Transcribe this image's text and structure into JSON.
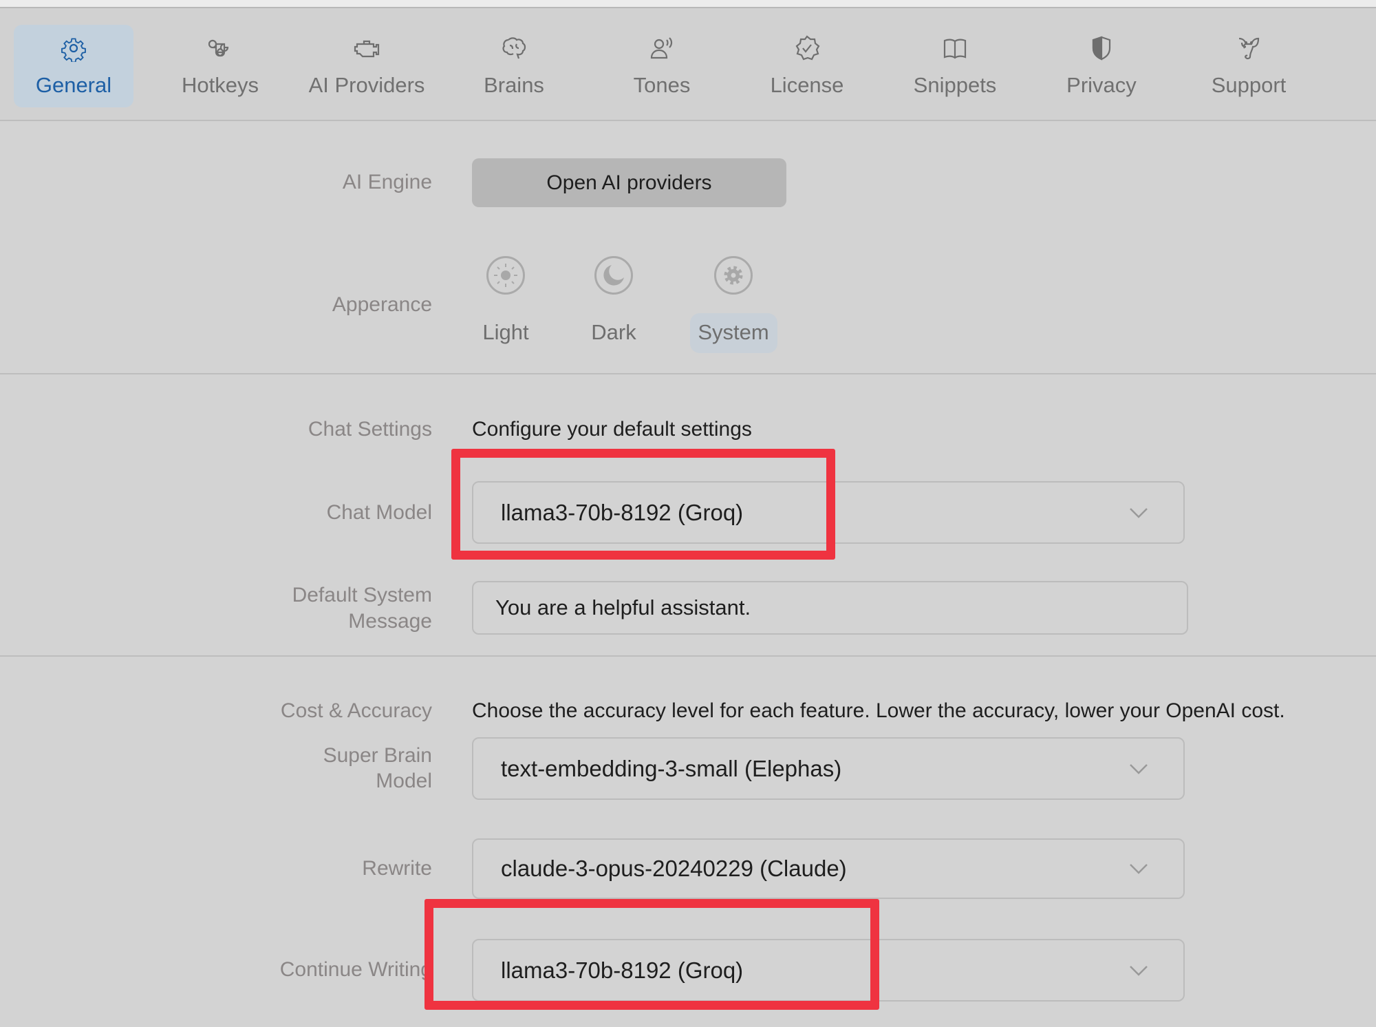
{
  "tabs": [
    {
      "label": "General",
      "icon": "gear-icon",
      "active": true
    },
    {
      "label": "Hotkeys",
      "icon": "command-icon"
    },
    {
      "label": "AI Providers",
      "icon": "engine-icon"
    },
    {
      "label": "Brains",
      "icon": "brain-icon"
    },
    {
      "label": "Tones",
      "icon": "speaking-person-icon"
    },
    {
      "label": "License",
      "icon": "checkmark-seal-icon"
    },
    {
      "label": "Snippets",
      "icon": "book-icon"
    },
    {
      "label": "Privacy",
      "icon": "shield-icon"
    },
    {
      "label": "Support",
      "icon": "elephant-icon"
    }
  ],
  "ai_engine": {
    "label": "AI Engine",
    "button": "Open AI providers"
  },
  "appearance": {
    "label": "Apperance",
    "options": [
      "Light",
      "Dark",
      "System"
    ],
    "selected": "System"
  },
  "chat": {
    "label": "Chat Settings",
    "description": "Configure your default settings",
    "model_label": "Chat Model",
    "model_value": "llama3-70b-8192 (Groq)",
    "system_label_1": "Default System",
    "system_label_2": "Message",
    "system_value": "You are a helpful assistant."
  },
  "cost": {
    "label": "Cost & Accuracy",
    "description": "Choose the accuracy level for each feature. Lower the accuracy, lower your OpenAI cost.",
    "super_brain_label_1": "Super Brain",
    "super_brain_label_2": "Model",
    "super_brain_value": "text-embedding-3-small (Elephas)",
    "rewrite_label": "Rewrite",
    "rewrite_value": "claude-3-opus-20240229 (Claude)",
    "continue_label": "Continue Writing",
    "continue_value": "llama3-70b-8192 (Groq)"
  },
  "colors": {
    "accent": "#1d5fa5",
    "highlight": "#ef3340"
  }
}
